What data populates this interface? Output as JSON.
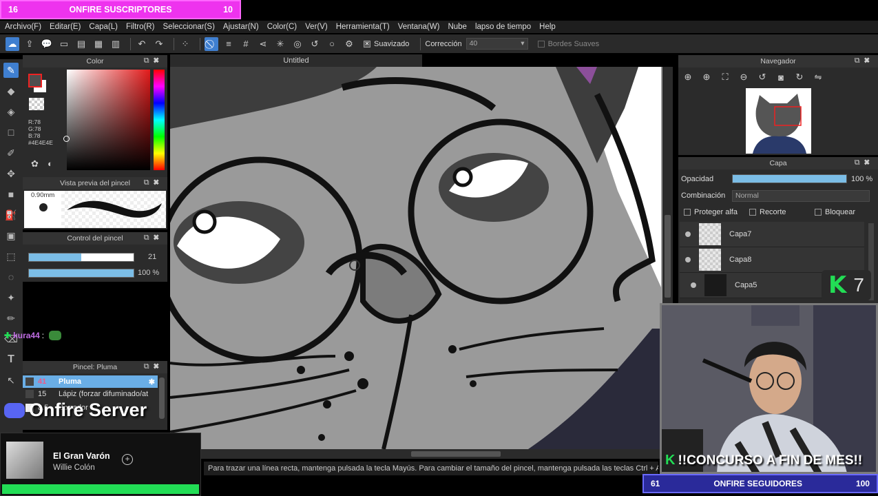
{
  "overlays": {
    "subs_left": "16",
    "subs_title": "ONFIRE SUSCRIPTORES",
    "subs_right": "10",
    "server_label": "Onfire Server",
    "kick_badge": "7",
    "contest_text": "!!CONCURSO A FIN DE MES!!",
    "followers_left": "61",
    "followers_title": "ONFIRE SEGUIDORES",
    "followers_right": "100",
    "chat_user": "kura44",
    "chat_sep": ":",
    "song_title": "El Gran Varón",
    "song_artist": "Willie Colón",
    "green_color": "#22dd55",
    "magenta_color": "#ee33ee"
  },
  "menu": [
    "Archivo(F)",
    "Editar(E)",
    "Capa(L)",
    "Filtro(R)",
    "Seleccionar(S)",
    "Ajustar(N)",
    "Color(C)",
    "Ver(V)",
    "Herramienta(T)",
    "Ventana(W)",
    "Nube",
    "lapso de tiempo",
    "Help"
  ],
  "toolbar": {
    "smooth_label": "Suavizado",
    "correction_label": "Corrección",
    "correction_value": "40",
    "soft_edges_label": "Bordes Suaves"
  },
  "color_panel": {
    "title": "Color",
    "r": "R:78",
    "g": "G:78",
    "b": "B:78",
    "hex": "#4E4E4E",
    "current_color": "#4e4e4e"
  },
  "brush_preview": {
    "title": "Vista previa del pincel",
    "size": "0.90mm"
  },
  "brush_control": {
    "title": "Control del pincel",
    "size_value": "21",
    "size_fraction": 0.5,
    "opacity_value": "100 %",
    "opacity_fraction": 1.0
  },
  "brush_list": {
    "title": "Pincel: Pluma",
    "items": [
      {
        "size": "41",
        "name": "Pluma"
      },
      {
        "size": "15",
        "name": "Lápiz (forzar difuminado/at"
      },
      {
        "size": "8.5",
        "name": "Borrador"
      }
    ]
  },
  "canvas": {
    "title": "Untitled"
  },
  "navigator": {
    "title": "Navegador"
  },
  "layers": {
    "title": "Capa",
    "opacity_label": "Opacidad",
    "opacity_value": "100 %",
    "opacity_fraction": 1.0,
    "blend_label": "Combinación",
    "blend_value": "Normal",
    "protect_alpha": "Proteger alfa",
    "clip": "Recorte",
    "lock": "Bloquear",
    "items": [
      {
        "name": "Capa7"
      },
      {
        "name": "Capa8"
      },
      {
        "name": "Capa5"
      }
    ]
  },
  "status": {
    "text": "Para trazar una línea recta, mantenga pulsada la tecla Mayús. Para cambiar el tamaño del pincel, mantenga pulsada las teclas Ctrl + Al"
  }
}
